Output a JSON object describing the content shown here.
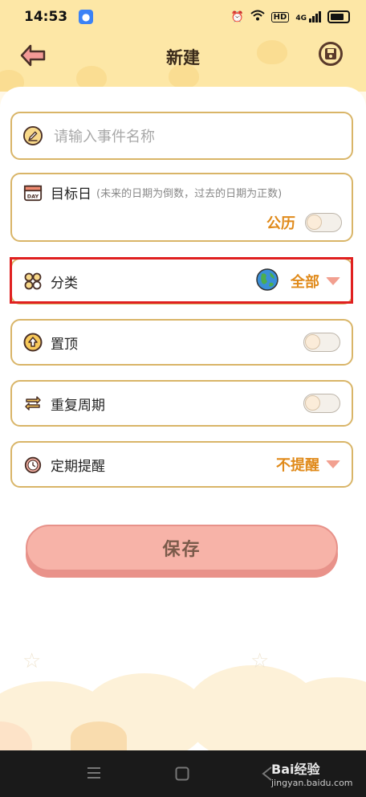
{
  "status_bar": {
    "time": "14:53",
    "network": "4G",
    "hd": "HD",
    "icons": [
      "baidu-paw-icon",
      "alarm-icon",
      "wifi-icon",
      "hd-icon",
      "signal-icon",
      "battery-icon"
    ]
  },
  "header": {
    "title": "新建",
    "back_icon": "arrow-left-icon",
    "save_icon": "floppy-disk-icon"
  },
  "form": {
    "event_name": {
      "placeholder": "请输入事件名称",
      "value": "",
      "icon": "pencil-icon"
    },
    "target_date": {
      "label": "目标日",
      "hint": "(未来的日期为倒数，过去的日期为正数)",
      "calendar_label": "公历",
      "calendar_toggle_on": false,
      "icon": "calendar-day-icon"
    },
    "category": {
      "label": "分类",
      "value": "全部",
      "icon": "grid-category-icon",
      "value_icon": "globe-icon"
    },
    "pin_top": {
      "label": "置顶",
      "toggle_on": false,
      "icon": "pin-up-icon"
    },
    "repeat": {
      "label": "重复周期",
      "toggle_on": false,
      "icon": "repeat-icon"
    },
    "reminder": {
      "label": "定期提醒",
      "value": "不提醒",
      "icon": "alarm-clock-icon"
    }
  },
  "actions": {
    "save_label": "保存"
  },
  "watermark": {
    "brand": "Bai经验",
    "url": "jingyan.baidu.com"
  },
  "colors": {
    "accent": "#e08a1a",
    "header_bg": "#fde7a6",
    "card_border": "#d9b568",
    "save_bg": "#f7b3a8",
    "highlight": "#e02020"
  }
}
